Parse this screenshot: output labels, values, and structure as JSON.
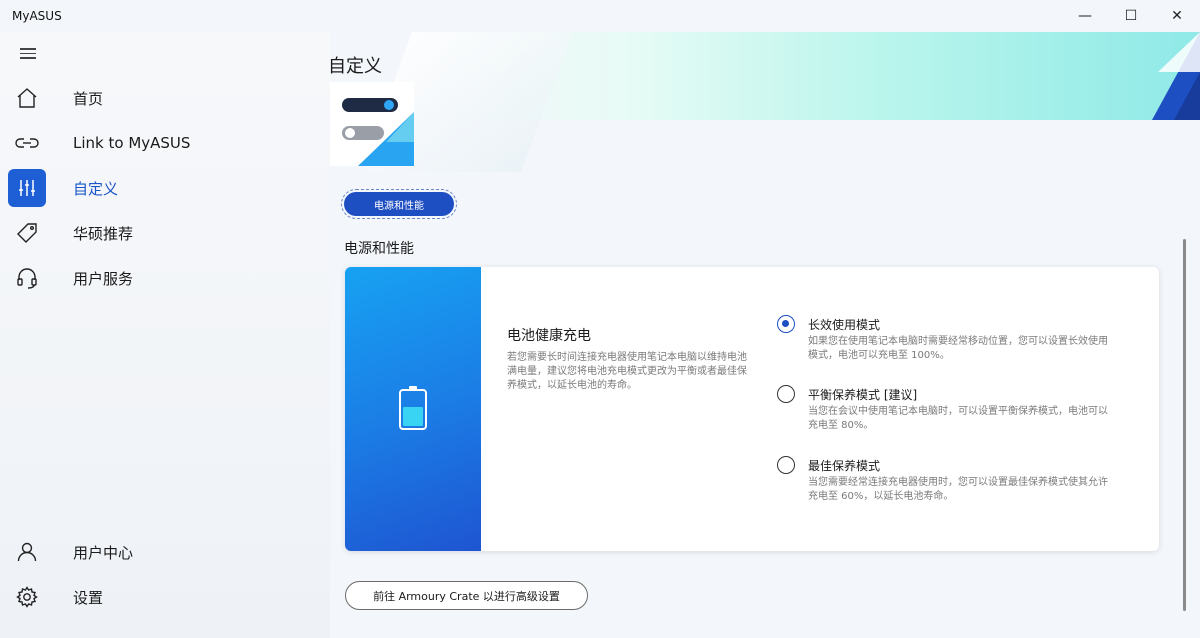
{
  "window": {
    "title": "MyASUS",
    "minimize_glyph": "—",
    "maximize_glyph": "☐",
    "close_glyph": "✕"
  },
  "sidebar": {
    "items": [
      {
        "label": "首页",
        "icon": "home-icon"
      },
      {
        "label": "Link to MyASUS",
        "icon": "link-icon"
      },
      {
        "label": "自定义",
        "icon": "sliders-icon",
        "active": true
      },
      {
        "label": "华硕推荐",
        "icon": "tag-icon"
      },
      {
        "label": "用户服务",
        "icon": "headset-icon"
      }
    ],
    "bottom_items": [
      {
        "label": "用户中心",
        "icon": "user-icon"
      },
      {
        "label": "设置",
        "icon": "gear-icon"
      }
    ]
  },
  "main": {
    "page_title": "自定义",
    "category_button": "电源和性能",
    "section_title": "电源和性能",
    "card": {
      "heading": "电池健康充电",
      "description": "若您需要长时间连接充电器使用笔记本电脑以维持电池满电量，建议您将电池充电模式更改为平衡或者最佳保养模式，以延长电池的寿命。",
      "options": [
        {
          "title": "长效使用模式",
          "description": "如果您在使用笔记本电脑时需要经常移动位置，您可以设置长效使用模式，电池可以充电至 100%。",
          "checked": true
        },
        {
          "title": "平衡保养模式 [建议]",
          "description": "当您在会议中使用笔记本电脑时，可以设置平衡保养模式，电池可以充电至 80%。",
          "checked": false
        },
        {
          "title": "最佳保养模式",
          "description": "当您需要经常连接充电器使用时，您可以设置最佳保养模式使其允许充电至 60%，以延长电池寿命。",
          "checked": false
        }
      ]
    },
    "armoury_button": "前往 Armoury Crate 以进行高级设置"
  },
  "colors": {
    "accent": "#1e4fc2",
    "active_icon_bg": "#1e5fd6",
    "card_gradient_top": "#17a2f2",
    "card_gradient_bottom": "#1e55d1"
  }
}
